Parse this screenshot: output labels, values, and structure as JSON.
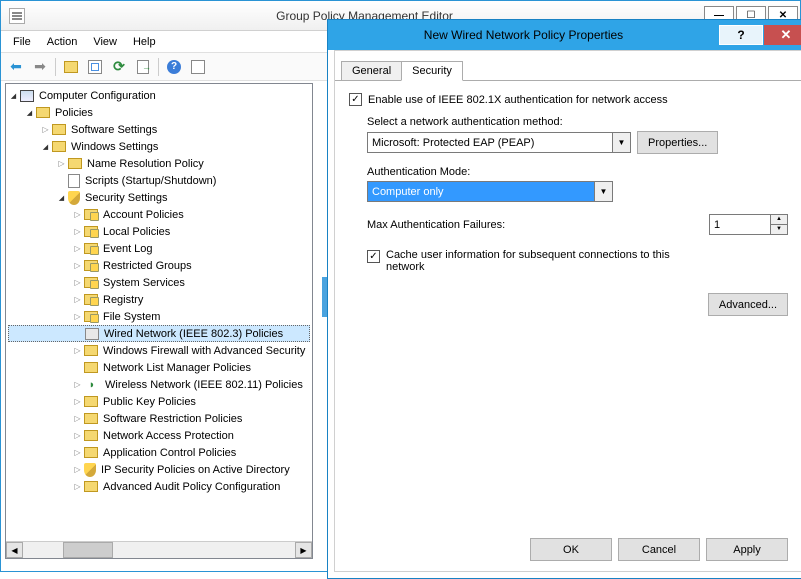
{
  "window": {
    "title": "Group Policy Management Editor"
  },
  "menubar": {
    "file": "File",
    "action": "Action",
    "view": "View",
    "help": "Help"
  },
  "tree": {
    "root": "Computer Configuration",
    "policies": "Policies",
    "software": "Software Settings",
    "windows": "Windows Settings",
    "nameres": "Name Resolution Policy",
    "scripts": "Scripts (Startup/Shutdown)",
    "security": "Security Settings",
    "account": "Account Policies",
    "local": "Local Policies",
    "eventlog": "Event Log",
    "restricted": "Restricted Groups",
    "sysservices": "System Services",
    "registry": "Registry",
    "filesystem": "File System",
    "wired": "Wired Network (IEEE 802.3) Policies",
    "firewall": "Windows Firewall with Advanced Security",
    "nlmp": "Network List Manager Policies",
    "wireless": "Wireless Network (IEEE 802.11) Policies",
    "pki": "Public Key Policies",
    "srp": "Software Restriction Policies",
    "nap": "Network Access Protection",
    "acp": "Application Control Policies",
    "ipsec": "IP Security Policies on Active Directory",
    "audit": "Advanced Audit Policy Configuration"
  },
  "dialog": {
    "title": "New Wired Network Policy Properties",
    "tabs": {
      "general": "General",
      "security": "Security"
    },
    "enable8021x": "Enable use of IEEE 802.1X authentication for network access",
    "authmethod_label": "Select a network authentication method:",
    "authmethod_value": "Microsoft: Protected EAP (PEAP)",
    "properties_btn": "Properties...",
    "authmode_label": "Authentication Mode:",
    "authmode_value": "Computer only",
    "maxfail_label": "Max Authentication Failures:",
    "maxfail_value": "1",
    "cache_label": "Cache user information for subsequent connections to this network",
    "advanced_btn": "Advanced...",
    "ok": "OK",
    "cancel": "Cancel",
    "apply": "Apply"
  }
}
